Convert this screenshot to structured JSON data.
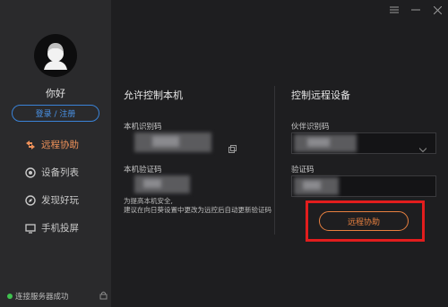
{
  "window": {
    "menu_icon": "hamburger-icon",
    "minimize_icon": "minimize-icon",
    "close_icon": "close-icon"
  },
  "sidebar": {
    "username": "你好",
    "login_label": "登录 / 注册",
    "nav": [
      {
        "label": "远程协助",
        "icon": "remote-assist-icon",
        "active": true
      },
      {
        "label": "设备列表",
        "icon": "device-list-icon",
        "active": false
      },
      {
        "label": "发现好玩",
        "icon": "discover-icon",
        "active": false
      },
      {
        "label": "手机投屏",
        "icon": "phone-mirror-icon",
        "active": false
      }
    ],
    "status_text": "连接服务器成功",
    "colors": {
      "accent": "#f0925a",
      "online": "#3fc24f",
      "login": "#3a83d8"
    }
  },
  "allow_section": {
    "title": "允许控制本机",
    "id_label": "本机识别码",
    "code_label": "本机验证码",
    "hint_line1": "为提高本机安全,",
    "hint_line2": "建议在向日葵设置中更改为远控后自动更新验证码"
  },
  "control_section": {
    "title": "控制远程设备",
    "partner_label": "伙伴识别码",
    "code_label": "验证码",
    "button_label": "远程协助",
    "button_color": "#e8803f",
    "highlight_color": "#e21d1d"
  }
}
